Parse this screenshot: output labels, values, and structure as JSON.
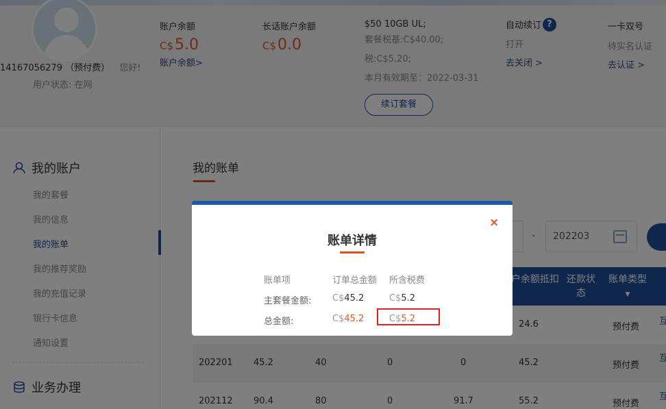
{
  "header": {
    "user_id": "14167056279",
    "user_plan": "（预付费）",
    "greeting": "您好!",
    "user_status": "用户状态: 在网",
    "balance": {
      "label": "账户余额",
      "currency": "C$",
      "amount": "5.0",
      "link": "账户余额>"
    },
    "longcall": {
      "label": "长话账户余额",
      "currency": "C$",
      "amount": "0.0"
    },
    "plan": {
      "name": "$50 10GB UL;",
      "base_tax": "套餐税基:C$40.00;",
      "tax": "税:C$5.20;",
      "valid_until": "本月有效期至：2022-03-31",
      "renew_button": "续订套餐"
    },
    "autorenew": {
      "label": "自动续订",
      "help_icon": "?",
      "status": "打开",
      "link": "去关闭 >"
    },
    "dual": {
      "label": "一卡双号",
      "status": "待实名认证",
      "link": "去认证 >"
    }
  },
  "sidebar": {
    "section1": "我的账户",
    "items": [
      "我的套餐",
      "我的信息",
      "我的账单",
      "我的推荐奖励",
      "我的充值记录",
      "银行卡信息",
      "通知设置"
    ],
    "active_index": 2,
    "section2": "业务办理"
  },
  "main": {
    "title": "我的账单",
    "date_separator": "-",
    "date_end": "202203",
    "table_headers": {
      "balance_deduct": "户余额抵扣",
      "repay_status": "还款状态",
      "bill_type": "账单类型"
    },
    "rows": [
      {
        "month": "",
        "total": "",
        "plan": "",
        "c3": "",
        "c4": "",
        "deduct": "24.6",
        "type": "预付费",
        "action": "互"
      },
      {
        "month": "202201",
        "total": "45.2",
        "plan": "40",
        "c3": "0",
        "c4": "0",
        "deduct": "45.2",
        "type": "预付费",
        "action": "互"
      },
      {
        "month": "202112",
        "total": "90.4",
        "plan": "80",
        "c3": "0",
        "c4": "91.7",
        "deduct": "55.2",
        "type": "预付费",
        "action": "互"
      }
    ]
  },
  "modal": {
    "title": "账单详情",
    "close_icon": "×",
    "headers": [
      "账单项",
      "订单总金额",
      "所含税费"
    ],
    "rows": [
      {
        "item": "主套餐金额:",
        "currency": "C$",
        "total": "45.2",
        "tax": "5.2",
        "highlight": false
      },
      {
        "item": "总金额:",
        "currency": "C$",
        "total": "45.2",
        "tax": "5.2",
        "highlight": true
      }
    ]
  },
  "colors": {
    "brand_blue": "#1f4e99",
    "accent_orange": "#d9531e",
    "amount_red": "#e0552b",
    "highlight_box": "#e02020"
  }
}
